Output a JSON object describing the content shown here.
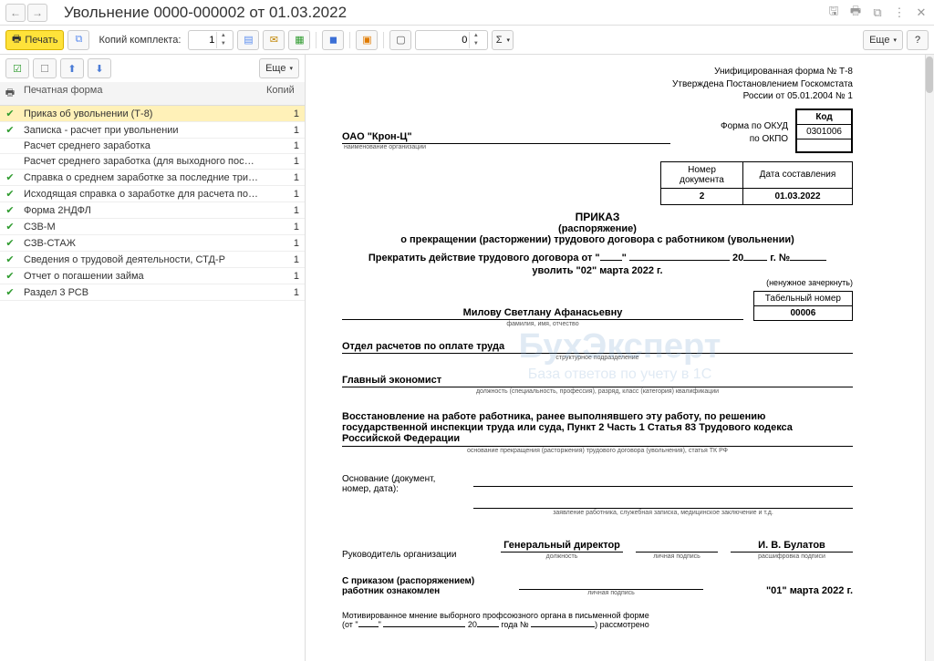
{
  "titlebar": {
    "title": "Увольнение 0000-000002 от 01.03.2022"
  },
  "toolbar": {
    "print_label": "Печать",
    "copies_label": "Копий комплекта:",
    "copies_value": "1",
    "zero_value": "0",
    "more_label": "Еще"
  },
  "left_toolbar": {
    "more_label": "Еще"
  },
  "forms_table": {
    "header_name": "Печатная форма",
    "header_count": "Копий",
    "rows": [
      {
        "checked": true,
        "name": "Приказ об увольнении (Т-8)",
        "count": "1",
        "selected": true
      },
      {
        "checked": true,
        "name": "Записка - расчет при увольнении",
        "count": "1"
      },
      {
        "checked": false,
        "name": "Расчет среднего заработка",
        "count": "1"
      },
      {
        "checked": false,
        "name": "Расчет среднего заработка (для выходного пособия)",
        "count": "1"
      },
      {
        "checked": true,
        "name": "Справка о среднем заработке за последние три ме...",
        "count": "1"
      },
      {
        "checked": true,
        "name": "Исходящая справка о заработке для расчета пособий",
        "count": "1"
      },
      {
        "checked": true,
        "name": "Форма 2НДФЛ",
        "count": "1"
      },
      {
        "checked": true,
        "name": "СЗВ-М",
        "count": "1"
      },
      {
        "checked": true,
        "name": "СЗВ-СТАЖ",
        "count": "1"
      },
      {
        "checked": true,
        "name": "Сведения о трудовой деятельности, СТД-Р",
        "count": "1"
      },
      {
        "checked": true,
        "name": "Отчет о погашении займа",
        "count": "1"
      },
      {
        "checked": true,
        "name": "Раздел 3 РСВ",
        "count": "1"
      }
    ]
  },
  "document": {
    "form_header_l1": "Унифицированная форма № Т-8",
    "form_header_l2": "Утверждена Постановлением Госкомстата",
    "form_header_l3": "России от 05.01.2004 № 1",
    "code_label": "Код",
    "okud_label": "Форма по ОКУД",
    "okud_value": "0301006",
    "okpo_label": "по ОКПО",
    "okpo_value": "",
    "org_name": "ОАО \"Крон-Ц\"",
    "org_sub": "наименование организации",
    "docno_header1": "Номер документа",
    "docno_header2": "Дата составления",
    "docno_value": "2",
    "docdate_value": "01.03.2022",
    "order_title": "ПРИКАЗ",
    "order_sub": "(распоряжение)",
    "order_line": "о прекращении (расторжении) трудового договора с работником (увольнении)",
    "terminate_prefix": "Прекратить действие трудового договора от \"",
    "terminate_mid": "\" ",
    "terminate_year": " 20",
    "terminate_suffix": " г. №",
    "dismiss_line": "уволить \"02\" марта 2022 г.",
    "strike_note": "(ненужное зачеркнуть)",
    "tabno_header": "Табельный номер",
    "tabno_value": "00006",
    "fio": "Милову Светлану Афанасьевну",
    "fio_sub": "фамилия, имя, отчество",
    "dept": "Отдел расчетов по оплате труда",
    "dept_sub": "структурное подразделение",
    "position": "Главный экономист",
    "position_sub": "должность (специальность, профессия), разряд, класс (категория) квалификации",
    "reason": "Восстановление на работе работника, ранее выполнявшего эту работу, по решению государственной инспекции труда или суда, Пункт 2 Часть 1 Статья 83 Трудового кодекса Российской Федерации",
    "reason_sub": "основание прекращения (расторжения) трудового договора (увольнения), статья ТК РФ",
    "basis_label1": "Основание (документ,",
    "basis_label2": "номер, дата):",
    "basis_sub": "заявление работника, служебная записка, медицинское заключение и т.д.",
    "head_label": "Руководитель организации",
    "head_position": "Генеральный директор",
    "head_name": "И. В. Булатов",
    "sig_sub_pos": "должность",
    "sig_sub_sign": "личная подпись",
    "sig_sub_name": "расшифровка подписи",
    "ack_label1": "С приказом (распоряжением)",
    "ack_label2": "работник ознакомлен",
    "ack_date": "\"01\" марта 2022 г.",
    "union_l1": "Мотивированное мнение выборного профсоюзного органа в письменной форме",
    "union_l2a": "(от \"",
    "union_l2b": "\" ",
    "union_l2c": " 20",
    "union_l2d": " года № ",
    "union_l2e": ") рассмотрено"
  },
  "watermark": {
    "main": "БухЭксперт",
    "sub": "База ответов по учету в 1С"
  }
}
